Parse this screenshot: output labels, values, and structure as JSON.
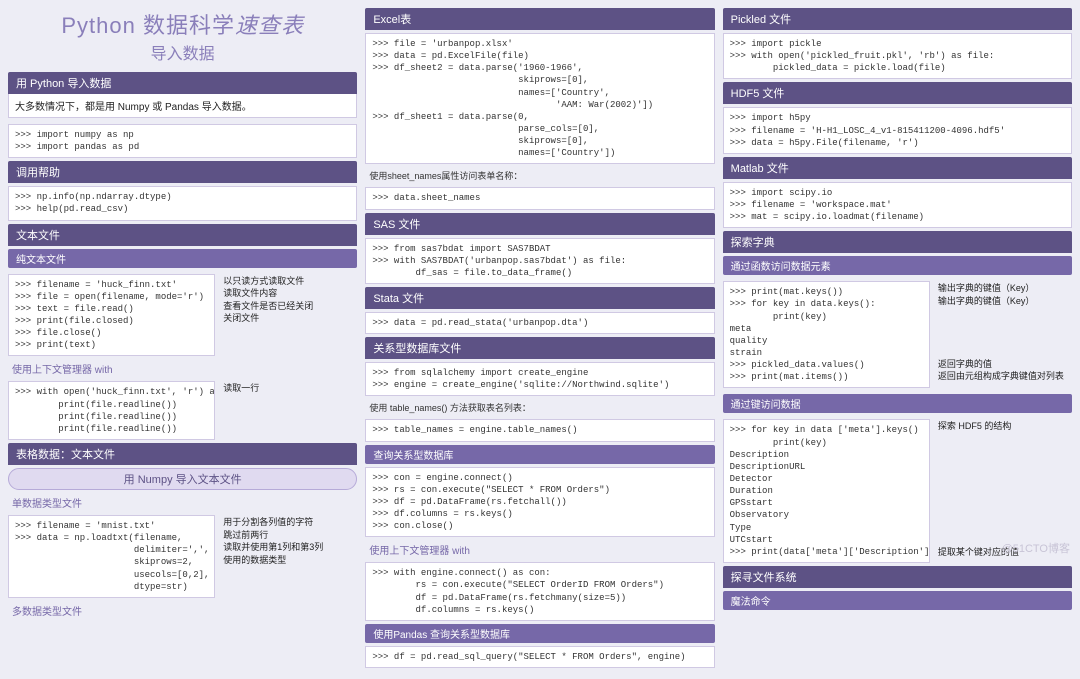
{
  "title": {
    "main_a": "Python 数据科学",
    "main_b": "速查表",
    "sub": "导入数据"
  },
  "watermark": "@51CTO博客",
  "c1": {
    "h_import": "用 Python 导入数据",
    "note_import": "大多数情况下，都是用 Numpy 或 Pandas 导入数据。",
    "code_import": ">>> import numpy as np\n>>> import pandas as pd",
    "h_help": "调用帮助",
    "code_help": ">>> np.info(np.ndarray.dtype)\n>>> help(pd.read_csv)",
    "h_text": "文本文件",
    "h_plain": "纯文本文件",
    "code_plain": ">>> filename = 'huck_finn.txt'\n>>> file = open(filename, mode='r')\n>>> text = file.read()\n>>> print(file.closed)\n>>> file.close()\n>>> print(text)",
    "side_plain": "以只读方式读取文件\n读取文件内容\n查看文件是否已经关闭\n关闭文件",
    "h_ctx": "使用上下文管理器 with",
    "code_ctx": ">>> with open('huck_finn.txt', 'r') as file:\n        print(file.readline())\n        print(file.readline())\n        print(file.readline())",
    "side_ctx": "读取一行",
    "h_tabular": "表格数据：文本文件",
    "pill_numpy": "用 Numpy 导入文本文件",
    "h_single": "单数据类型文件",
    "code_single": ">>> filename = 'mnist.txt'\n>>> data = np.loadtxt(filename,\n                      delimiter=',',\n                      skiprows=2,\n                      usecols=[0,2],\n                      dtype=str)",
    "side_single": "用于分割各列值的字符\n跳过前两行\n读取并使用第1列和第3列\n使用的数据类型",
    "h_multi": "多数据类型文件"
  },
  "c2": {
    "h_excel": "Excel表",
    "code_excel": ">>> file = 'urbanpop.xlsx'\n>>> data = pd.ExcelFile(file)\n>>> df_sheet2 = data.parse('1960-1966',\n                           skiprows=[0],\n                           names=['Country',\n                                  'AAM: War(2002)'])\n>>> df_sheet1 = data.parse(0,\n                           parse_cols=[0],\n                           skiprows=[0],\n                           names=['Country'])",
    "caption_excel": "使用sheet_names属性访问表单名称：",
    "code_excel2": ">>> data.sheet_names",
    "h_sas": "SAS 文件",
    "code_sas": ">>> from sas7bdat import SAS7BDAT\n>>> with SAS7BDAT('urbanpop.sas7bdat') as file:\n        df_sas = file.to_data_frame()",
    "h_stata": "Stata 文件",
    "code_stata": ">>> data = pd.read_stata('urbanpop.dta')",
    "h_rdb": "关系型数据库文件",
    "code_rdb1": ">>> from sqlalchemy import create_engine\n>>> engine = create_engine('sqlite://Northwind.sqlite')",
    "caption_rdb": "使用 table_names() 方法获取表名列表：",
    "code_rdb2": ">>> table_names = engine.table_names()",
    "h_query": "查询关系型数据库",
    "code_query": ">>> con = engine.connect()\n>>> rs = con.execute(\"SELECT * FROM Orders\")\n>>> df = pd.DataFrame(rs.fetchall())\n>>> df.columns = rs.keys()\n>>> con.close()",
    "h_qctx": "使用上下文管理器 with",
    "code_qctx": ">>> with engine.connect() as con:\n        rs = con.execute(\"SELECT OrderID FROM Orders\")\n        df = pd.DataFrame(rs.fetchmany(size=5))\n        df.columns = rs.keys()",
    "h_qpd": "使用Pandas 查询关系型数据库",
    "code_qpd": ">>> df = pd.read_sql_query(\"SELECT * FROM Orders\", engine)"
  },
  "c3": {
    "h_pickle": "Pickled 文件",
    "code_pickle": ">>> import pickle\n>>> with open('pickled_fruit.pkl', 'rb') as file:\n        pickled_data = pickle.load(file)",
    "h_hdf5": "HDF5 文件",
    "code_hdf5": ">>> import h5py\n>>> filename = 'H-H1_LOSC_4_v1-815411200-4096.hdf5'\n>>> data = h5py.File(filename, 'r')",
    "h_matlab": "Matlab 文件",
    "code_matlab": ">>> import scipy.io\n>>> filename = 'workspace.mat'\n>>> mat = scipy.io.loadmat(filename)",
    "h_explore": "探索字典",
    "h_func": "通过函数访问数据元素",
    "code_func": ">>> print(mat.keys())\n>>> for key in data.keys():\n        print(key)\nmeta\nquality\nstrain\n>>> pickled_data.values()\n>>> print(mat.items())",
    "side_func": "输出字典的键值（Key）\n输出字典的键值（Key）\n\n\n\n\n返回字典的值\n返回由元组构成字典键值对列表",
    "h_key": "通过键访问数据",
    "code_key": ">>> for key in data ['meta'].keys()\n        print(key)\nDescription\nDescriptionURL\nDetector\nDuration\nGPSstart\nObservatory\nType\nUTCstart\n>>> print(data['meta']['Description'].value)",
    "side_key": "探索 HDF5 的结构\n\n\n\n\n\n\n\n\n\n提取某个键对应的值",
    "h_fs": "探寻文件系统",
    "h_magic": "魔法命令"
  }
}
